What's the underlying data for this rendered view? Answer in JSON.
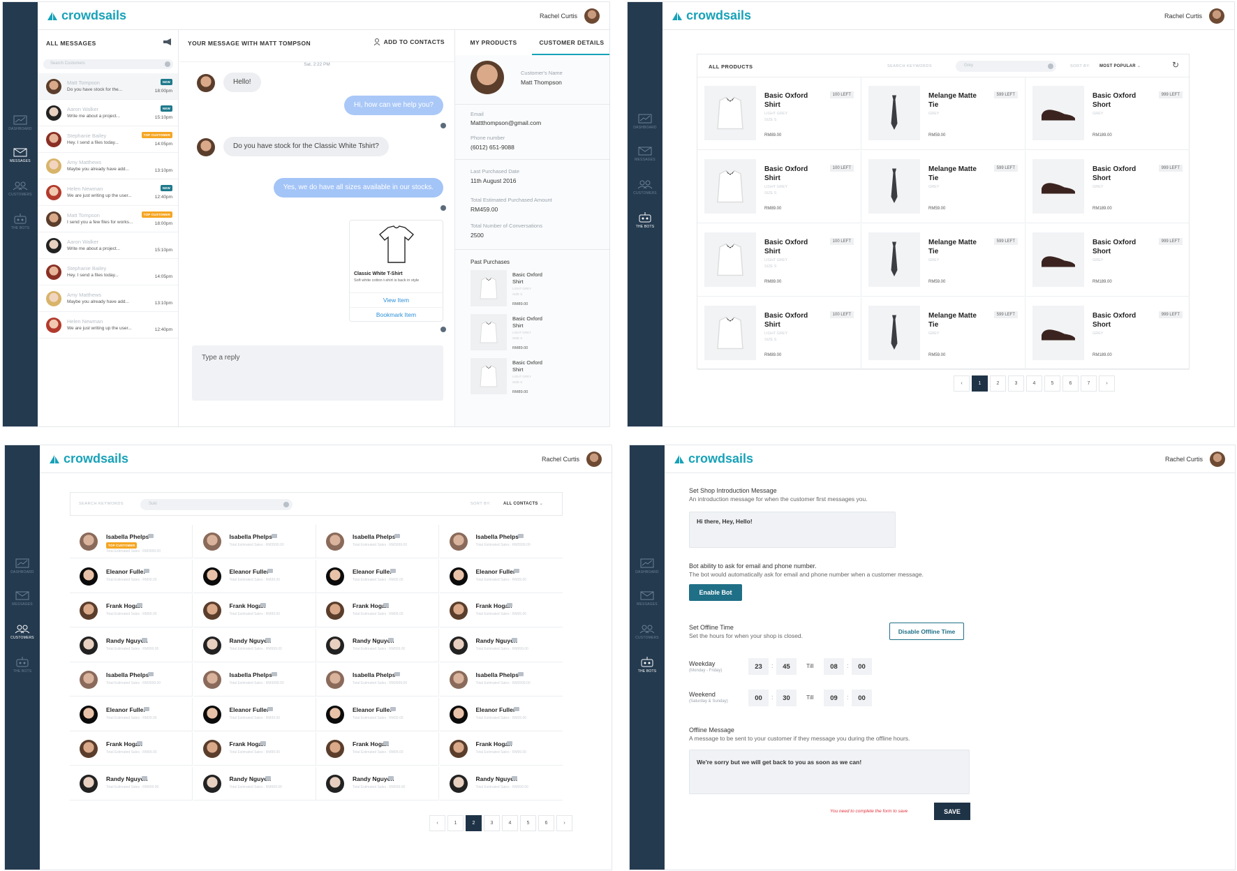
{
  "app": {
    "brand": "crowdsails",
    "user_name": "Rachel Curtis"
  },
  "nav": {
    "dashboard": "DASHBOARD",
    "messages": "MESSAGES",
    "customers": "CUSTOMERS",
    "bots": "THE BOTS"
  },
  "messages_panel": {
    "list_title": "ALL MESSAGES",
    "search_placeholder": "Search Customers",
    "conversations": [
      {
        "name": "Matt Tompson",
        "preview": "Do you have stock for the...",
        "time": "18:00pm",
        "badge": "NEW"
      },
      {
        "name": "Aaron Walker",
        "preview": "Write me about a project...",
        "time": "15:10pm",
        "badge": "NEW"
      },
      {
        "name": "Stephanie Bailey",
        "preview": "Hey. I send a files today...",
        "time": "14:05pm",
        "badge": "TOP CUSTOMER"
      },
      {
        "name": "Amy Matthews",
        "preview": "Maybe you already have add...",
        "time": "13:10pm",
        "badge": ""
      },
      {
        "name": "Helen Newman",
        "preview": "We are just writing up the user...",
        "time": "12:40pm",
        "badge": "NEW"
      },
      {
        "name": "Matt Tompson",
        "preview": "I send you a few files for works...",
        "time": "18:00pm",
        "badge": "TOP CUSTOMER"
      },
      {
        "name": "Aaron Walker",
        "preview": "Write me about a project...",
        "time": "15:10pm",
        "badge": ""
      },
      {
        "name": "Stephanie Bailey",
        "preview": "Hey. I send a files today...",
        "time": "14:05pm",
        "badge": ""
      },
      {
        "name": "Amy Matthews",
        "preview": "Maybe you already have add...",
        "time": "13:10pm",
        "badge": ""
      },
      {
        "name": "Helen Newman",
        "preview": "We are just writing up the user...",
        "time": "12:40pm",
        "badge": ""
      }
    ],
    "chat_title": "YOUR MESSAGE WITH MATT TOMPSON",
    "add_contacts": "ADD TO CONTACTS",
    "date_divider": "Sat, 2:22 PM",
    "msg1": "Hello!",
    "msg2": "Hi, how can we help you?",
    "msg3": "Do you have stock for the Classic White Tshirt?",
    "msg4": "Yes, we do have all sizes available in our stocks.",
    "card_title": "Classic White T-Shirt",
    "card_desc": "Soft white cotton t-shirt is back in style",
    "card_view": "View Item",
    "card_bookmark": "Bookmark Item",
    "reply_placeholder": "Type a reply",
    "tab_products": "MY PRODUCTS",
    "tab_details": "CUSTOMER DETAILS",
    "cust_name_label": "Customer's Name",
    "cust_name": "Matt Thompson",
    "email_label": "Email",
    "email": "Mattthompson@gmail.com",
    "phone_label": "Phone number",
    "phone": "(6012) 651-9088",
    "last_label": "Last Purchased Date",
    "last_date": "11th August 2016",
    "total_amount_label": "Total Estimated Purchased Amount",
    "total_amount": "RM459.00",
    "total_conv_label": "Total Number of Conversations",
    "total_conv": "2500",
    "past_label": "Past Purchases",
    "past": [
      {
        "name": "Basic Oxford Shirt",
        "color": "LIGHT GREY",
        "size": "SIZE S",
        "price": "RM89.00"
      },
      {
        "name": "Basic Oxford Shirt",
        "color": "LIGHT GREY",
        "size": "SIZE S",
        "price": "RM89.00"
      },
      {
        "name": "Basic Oxford Shirt",
        "color": "LIGHT GREY",
        "size": "SIZE S",
        "price": "RM89.00"
      }
    ]
  },
  "products_panel": {
    "title": "ALL PRODUCTS",
    "search_label": "SEARCH KEYWORDS",
    "search_value": "Grey",
    "sort_label": "SORT BY:",
    "sort_value": "MOST POPULAR",
    "products": [
      {
        "name": "Basic Oxford Shirt",
        "left": "100 LEFT",
        "m1": "LIGHT GREY",
        "m2": "SIZE S",
        "price": "RM89.00",
        "kind": "shirt"
      },
      {
        "name": "Melange Matte Tie",
        "left": "599 LEFT",
        "m1": "GREY",
        "m2": "",
        "price": "RM59.00",
        "kind": "tie"
      },
      {
        "name": "Basic Oxford Short",
        "left": "999 LEFT",
        "m1": "GREY",
        "m2": "",
        "price": "RM189.00",
        "kind": "shoe"
      }
    ],
    "pages": [
      "1",
      "2",
      "3",
      "4",
      "5",
      "6",
      "7"
    ],
    "current_page": "1"
  },
  "customers_panel": {
    "search_label": "SEARCH KEYWORDS",
    "search_value": "Suki",
    "sort_label": "SORT BY:",
    "sort_value": "ALL CONTACTS",
    "rows": [
      {
        "name": "Isabella Phelps",
        "sales": "Total Estimated Sales : RM3999.00",
        "tone": "f7"
      },
      {
        "name": "Eleanor Fuller",
        "sales": "Total Estimated Sales : RM39.00",
        "tone": "f6"
      },
      {
        "name": "Frank Hogan",
        "sales": "Total Estimated Sales : RM99.00",
        "tone": "f1"
      },
      {
        "name": "Randy Nguyen",
        "sales": "Total Estimated Sales : RM999.00",
        "tone": "f2"
      }
    ],
    "top_badge": "TOP CUSTOMER",
    "pages": [
      "1",
      "2",
      "3",
      "4",
      "5",
      "6"
    ],
    "current_page": "2"
  },
  "bots_panel": {
    "intro_title": "Set Shop Introduction Message",
    "intro_desc": "An introduction message for when the customer first messages you.",
    "intro_value": "Hi there, Hey, Hello!",
    "bot_title": "Bot ability to ask for email and phone number.",
    "bot_desc": "The bot would automatically ask for email and phone number when a customer message.",
    "enable_bot": "Enable Bot",
    "offline_title": "Set Offline Time",
    "offline_desc": "Set the hours for when your shop is closed.",
    "disable_offline": "Disable Offline Time",
    "weekday": "Weekday",
    "weekday_sub": "(Monday - Friday)",
    "weekday_from_h": "23",
    "weekday_from_m": "45",
    "weekday_to_h": "08",
    "weekday_to_m": "00",
    "weekend": "Weekend",
    "weekend_sub": "(Saturday & Sunday)",
    "weekend_from_h": "00",
    "weekend_from_m": "30",
    "weekend_to_h": "09",
    "weekend_to_m": "00",
    "till": "Till",
    "offline_msg_title": "Offline Message",
    "offline_msg_desc": "A message to be sent to your customer if they message you during the offline hours.",
    "offline_msg_value": "We're sorry but we will get back to you as soon as we can!",
    "form_warning": "You need to complete the form to save",
    "save": "SAVE"
  },
  "colors": {
    "sidebar": "#243a4f",
    "brand": "#17a2b8",
    "bubble_out": "#a3c4f7",
    "accent_btn": "#1f6f87",
    "badge_top": "#f5a623",
    "warning": "#e0323c"
  }
}
